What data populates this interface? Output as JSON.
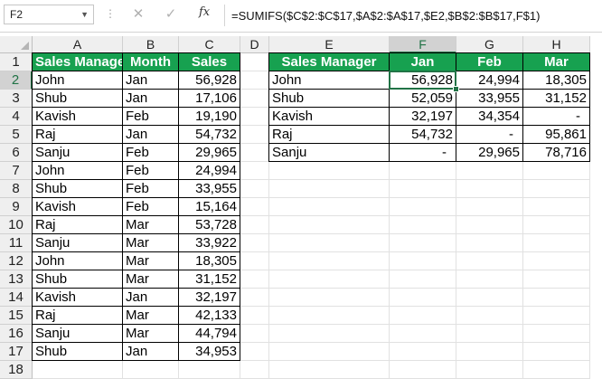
{
  "formula_bar": {
    "name_box": "F2",
    "cancel_icon": "✕",
    "enter_icon": "✓",
    "fx_label": "fx",
    "formula": "=SUMIFS($C$2:$C$17,$A$2:$A$17,$E2,$B$2:$B$17,F$1)"
  },
  "columns": [
    "A",
    "B",
    "C",
    "D",
    "E",
    "F",
    "G",
    "H"
  ],
  "rows": [
    "1",
    "2",
    "3",
    "4",
    "5",
    "6",
    "7",
    "8",
    "9",
    "10",
    "11",
    "12",
    "13",
    "14",
    "15",
    "16",
    "17",
    "18"
  ],
  "source_table": {
    "headers": [
      "Sales Manager",
      "Month",
      "Sales"
    ],
    "rows": [
      [
        "John",
        "Jan",
        "56,928"
      ],
      [
        "Shub",
        "Jan",
        "17,106"
      ],
      [
        "Kavish",
        "Feb",
        "19,190"
      ],
      [
        "Raj",
        "Jan",
        "54,732"
      ],
      [
        "Sanju",
        "Feb",
        "29,965"
      ],
      [
        "John",
        "Feb",
        "24,994"
      ],
      [
        "Shub",
        "Feb",
        "33,955"
      ],
      [
        "Kavish",
        "Feb",
        "15,164"
      ],
      [
        "Raj",
        "Mar",
        "53,728"
      ],
      [
        "Sanju",
        "Mar",
        "33,922"
      ],
      [
        "John",
        "Mar",
        "18,305"
      ],
      [
        "Shub",
        "Mar",
        "31,152"
      ],
      [
        "Kavish",
        "Jan",
        "32,197"
      ],
      [
        "Raj",
        "Mar",
        "42,133"
      ],
      [
        "Sanju",
        "Mar",
        "44,794"
      ],
      [
        "Shub",
        "Jan",
        "34,953"
      ]
    ]
  },
  "summary_table": {
    "headers": [
      "Sales Manager",
      "Jan",
      "Feb",
      "Mar"
    ],
    "rows": [
      [
        "John",
        "56,928",
        "24,994",
        "18,305"
      ],
      [
        "Shub",
        "52,059",
        "33,955",
        "31,152"
      ],
      [
        "Kavish",
        "32,197",
        "34,354",
        "-"
      ],
      [
        "Raj",
        "54,732",
        "-",
        "95,861"
      ],
      [
        "Sanju",
        "-",
        "29,965",
        "78,716"
      ]
    ]
  },
  "selection": {
    "active_cell": "F2",
    "active_column": "F",
    "active_row": "2"
  },
  "colors": {
    "header_fill": "#17a150",
    "accent": "#217346"
  }
}
